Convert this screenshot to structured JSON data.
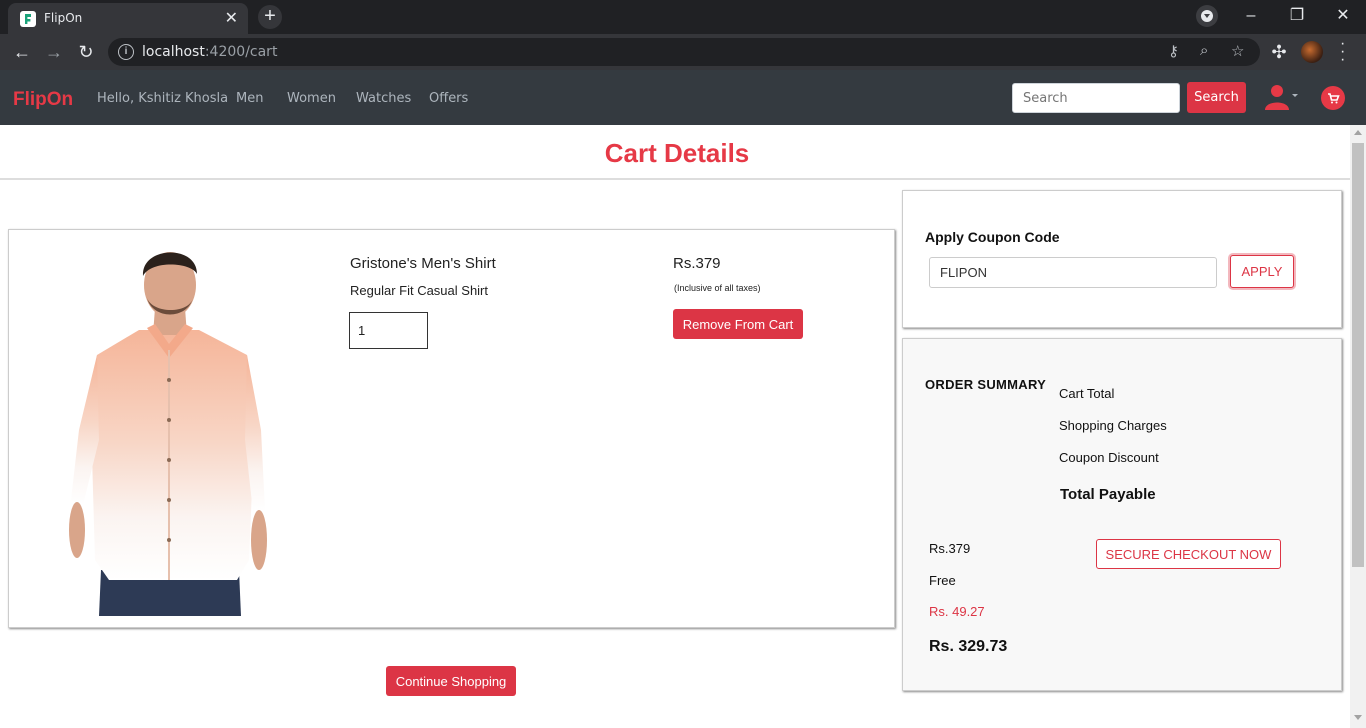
{
  "browser": {
    "tab_title": "FlipOn",
    "url_host": "localhost",
    "url_rest": ":4200/cart"
  },
  "nav": {
    "brand": "FlipOn",
    "greeting": "Hello, Kshitiz Khosla",
    "links": [
      "Men",
      "Women",
      "Watches",
      "Offers"
    ],
    "search_placeholder": "Search",
    "search_button": "Search"
  },
  "page": {
    "title": "Cart Details"
  },
  "product": {
    "name": "Gristone's Men's Shirt",
    "description": "Regular Fit Casual Shirt",
    "quantity": "1",
    "price": "Rs.379",
    "tax_note": "(Inclusive of all taxes)",
    "remove_label": "Remove From Cart"
  },
  "continue_label": "Continue Shopping",
  "coupon": {
    "title": "Apply Coupon Code",
    "value": "FLIPON",
    "apply_label": "APPLY"
  },
  "summary": {
    "title": "ORDER SUMMARY",
    "labels": [
      "Cart Total",
      "Shopping Charges",
      "Coupon Discount"
    ],
    "total_label": "Total Payable",
    "values": [
      "Rs.379",
      "Free",
      "Rs. 49.27"
    ],
    "total_value": "Rs. 329.73",
    "checkout_label": "SECURE CHECKOUT NOW"
  },
  "colors": {
    "accent": "#dc3545",
    "navbar": "#343a40"
  }
}
